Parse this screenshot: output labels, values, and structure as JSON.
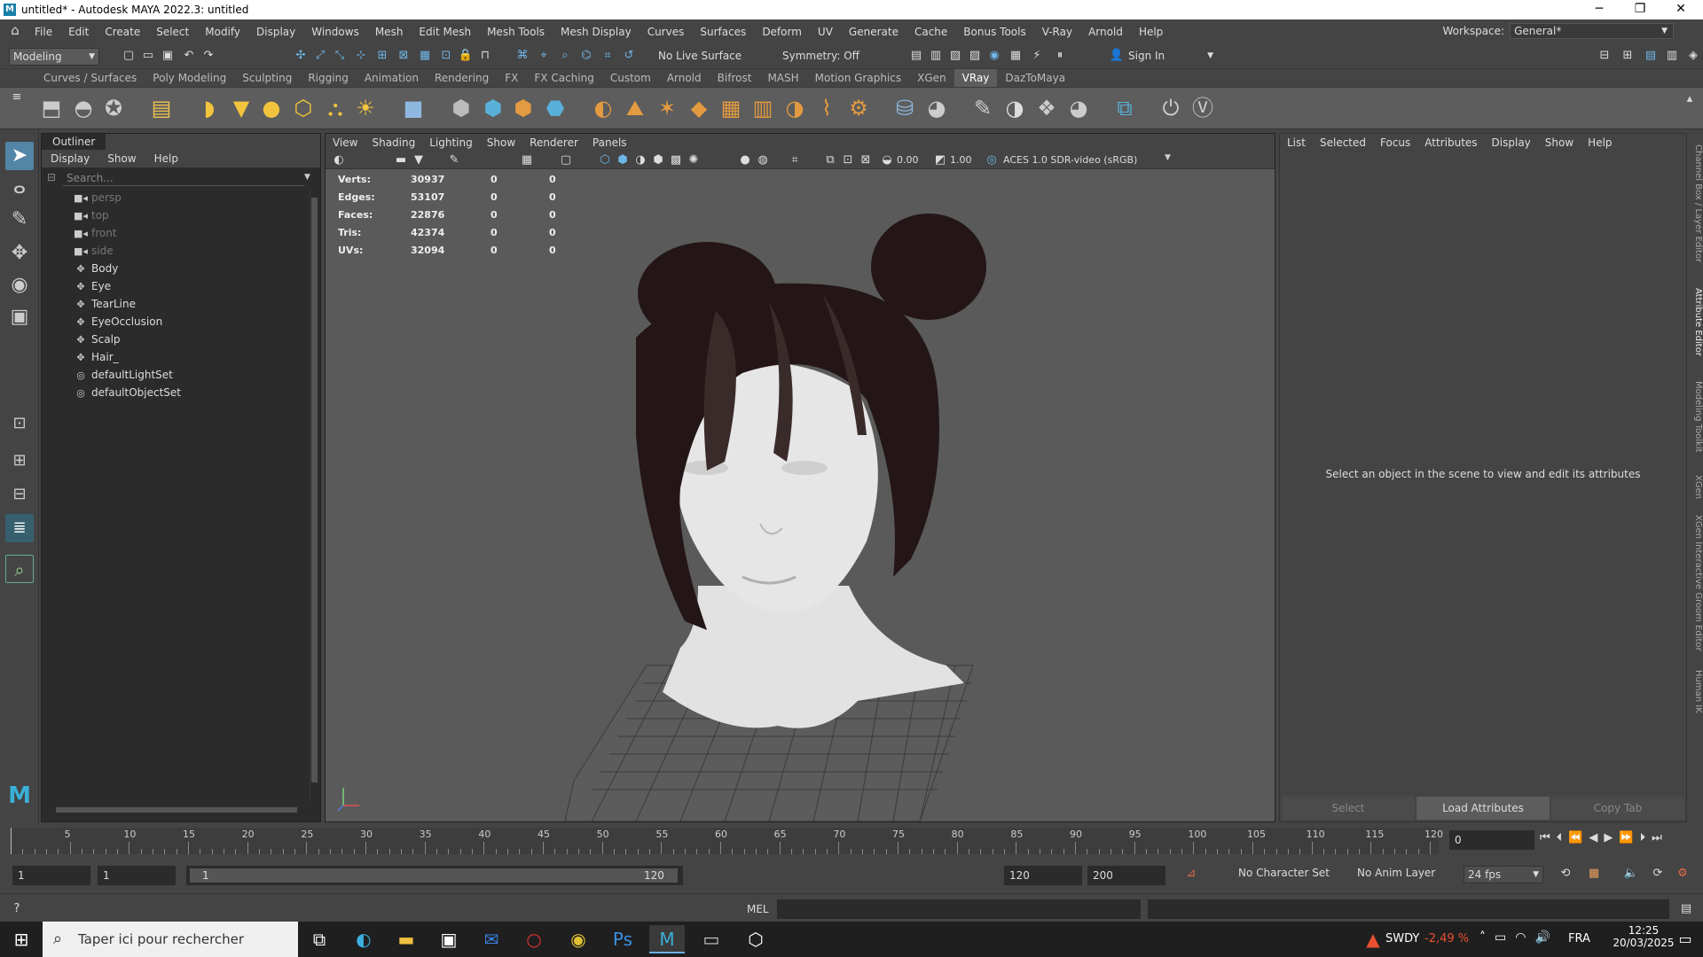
{
  "window": {
    "title": "untitled* - Autodesk MAYA 2022.3: untitled",
    "icon": "maya-logo-icon",
    "controls": [
      "─",
      "❐",
      "✕"
    ]
  },
  "menubar": {
    "items": [
      "File",
      "Edit",
      "Create",
      "Select",
      "Modify",
      "Display",
      "Windows",
      "Mesh",
      "Edit Mesh",
      "Mesh Tools",
      "Mesh Display",
      "Curves",
      "Surfaces",
      "Deform",
      "UV",
      "Generate",
      "Cache",
      "Bonus Tools",
      "V-Ray",
      "Arnold",
      "Help"
    ],
    "workspace_label": "Workspace:",
    "workspace_value": "General*"
  },
  "statusline": {
    "mode": "Modeling",
    "live_surface": "No Live Surface",
    "symmetry": "Symmetry: Off",
    "sign_in": "Sign In"
  },
  "shelf": {
    "tabs": [
      "Curves / Surfaces",
      "Poly Modeling",
      "Sculpting",
      "Rigging",
      "Animation",
      "Rendering",
      "FX",
      "FX Caching",
      "Custom",
      "Arnold",
      "Bifrost",
      "MASH",
      "Motion Graphics",
      "XGen",
      "VRay",
      "DazToMaya"
    ],
    "active_tab": "VRay"
  },
  "outliner": {
    "title": "Outliner",
    "menu": [
      "Display",
      "Show",
      "Help"
    ],
    "search_placeholder": "Search...",
    "items": [
      {
        "label": "persp",
        "icon": "camera-icon",
        "dim": true
      },
      {
        "label": "top",
        "icon": "camera-icon",
        "dim": true
      },
      {
        "label": "front",
        "icon": "camera-icon",
        "dim": true
      },
      {
        "label": "side",
        "icon": "camera-icon",
        "dim": true
      },
      {
        "label": "Body",
        "icon": "transform-icon",
        "dim": false
      },
      {
        "label": "Eye",
        "icon": "transform-icon",
        "dim": false
      },
      {
        "label": "TearLine",
        "icon": "transform-icon",
        "dim": false
      },
      {
        "label": "EyeOcclusion",
        "icon": "transform-icon",
        "dim": false
      },
      {
        "label": "Scalp",
        "icon": "transform-icon",
        "dim": false
      },
      {
        "label": "Hair_",
        "icon": "transform-icon",
        "dim": false
      },
      {
        "label": "defaultLightSet",
        "icon": "set-icon",
        "dim": false
      },
      {
        "label": "defaultObjectSet",
        "icon": "set-icon",
        "dim": false
      }
    ]
  },
  "viewport": {
    "menu": [
      "View",
      "Shading",
      "Lighting",
      "Show",
      "Renderer",
      "Panels"
    ],
    "exposure": "0.00",
    "gamma": "1.00",
    "colorspace": "ACES 1.0 SDR-video (sRGB)",
    "hud": [
      {
        "label": "Verts:",
        "v1": "30937",
        "v2": "0",
        "v3": "0"
      },
      {
        "label": "Edges:",
        "v1": "53107",
        "v2": "0",
        "v3": "0"
      },
      {
        "label": "Faces:",
        "v1": "22876",
        "v2": "0",
        "v3": "0"
      },
      {
        "label": "Tris:",
        "v1": "42374",
        "v2": "0",
        "v3": "0"
      },
      {
        "label": "UVs:",
        "v1": "32094",
        "v2": "0",
        "v3": "0"
      }
    ]
  },
  "attribute_editor": {
    "menu": [
      "List",
      "Selected",
      "Focus",
      "Attributes",
      "Display",
      "Show",
      "Help"
    ],
    "message": "Select an object in the scene to view and edit its attributes",
    "buttons": [
      "Select",
      "Load Attributes",
      "Copy Tab"
    ],
    "side_tabs": [
      "Channel Box / Layer Editor",
      "Attribute Editor",
      "Modeling Toolkit",
      "XGen",
      "XGen Interactive Groom Editor",
      "Human IK"
    ]
  },
  "timeline": {
    "ticks": [
      "5",
      "10",
      "15",
      "20",
      "25",
      "30",
      "35",
      "40",
      "45",
      "50",
      "55",
      "60",
      "65",
      "70",
      "75",
      "80",
      "85",
      "90",
      "95",
      "100",
      "105",
      "110",
      "115",
      "120"
    ],
    "current_frame": "0"
  },
  "range": {
    "start": "1",
    "playback_start": "1",
    "range_start_label": "1",
    "range_end_label": "120",
    "playback_end": "120",
    "end": "200",
    "character_set": "No Character Set",
    "anim_layer": "No Anim Layer",
    "fps": "24 fps"
  },
  "command": {
    "label": "MEL"
  },
  "taskbar": {
    "search_placeholder": "Taper ici pour rechercher",
    "ticker": "SWDY",
    "ticker_change": "-2,49 %",
    "language": "FRA",
    "time": "12:25",
    "date": "20/03/2025"
  }
}
